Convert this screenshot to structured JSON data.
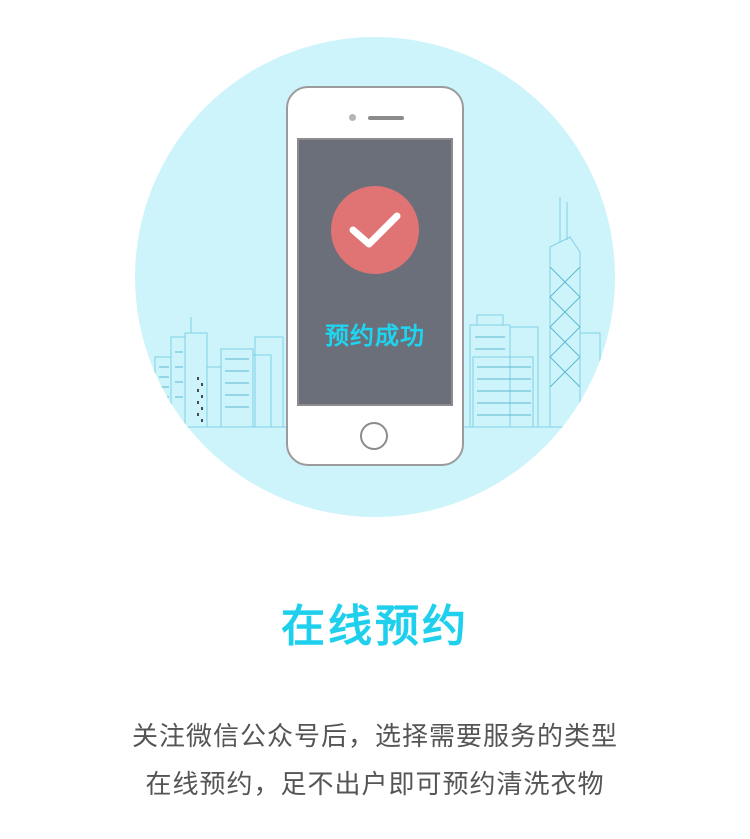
{
  "phone_screen": {
    "status_text": "预约成功",
    "icon": "checkmark-icon"
  },
  "section": {
    "title": "在线预约",
    "description_line1": "关注微信公众号后，选择需要服务的类型",
    "description_line2": "在线预约，足不出户即可预约清洗衣物"
  },
  "colors": {
    "accent": "#1fd0ed",
    "circle_bg": "#cdf4fb",
    "check_red": "#e07373",
    "screen_gray": "#6b6f7a",
    "body_text": "#555555"
  }
}
